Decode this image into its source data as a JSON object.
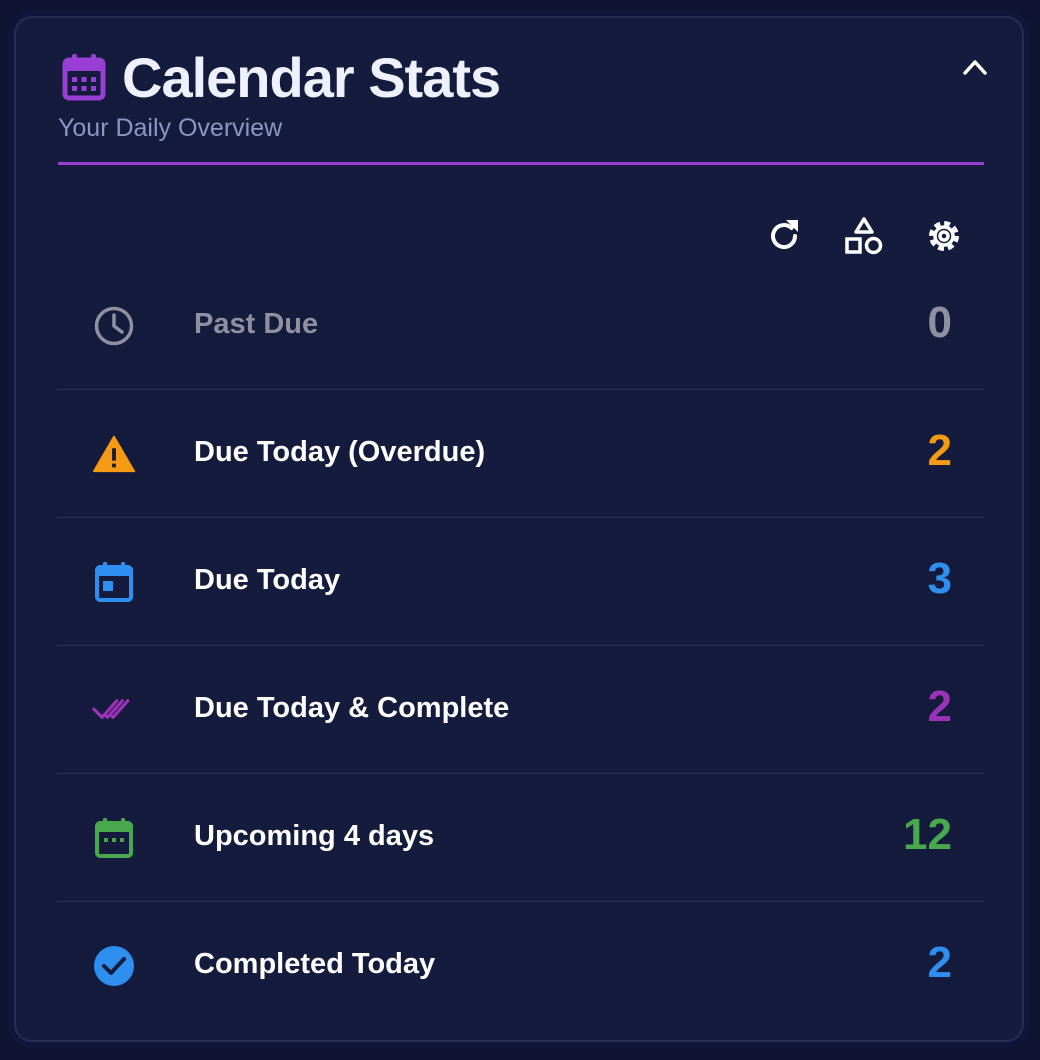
{
  "header": {
    "title": "Calendar Stats",
    "subtitle": "Your Daily Overview",
    "title_icon": "calendar-month-icon",
    "accent_color": "#9a3fd6",
    "collapse_icon": "chevron-up-icon"
  },
  "toolbar": {
    "items": [
      {
        "icon": "refresh-icon"
      },
      {
        "icon": "shapes-icon"
      },
      {
        "icon": "gear-icon"
      }
    ]
  },
  "stats": [
    {
      "label": "Past Due",
      "value": "0",
      "icon": "clock-icon",
      "color": "#8e929f"
    },
    {
      "label": "Due Today (Overdue)",
      "value": "2",
      "icon": "warning-icon",
      "color": "#f59a13"
    },
    {
      "label": "Due Today",
      "value": "3",
      "icon": "calendar-today-icon",
      "color": "#2f8ff0"
    },
    {
      "label": "Due Today & Complete",
      "value": "2",
      "icon": "double-check-icon",
      "color": "#9b32b8"
    },
    {
      "label": "Upcoming 4 days",
      "value": "12",
      "icon": "calendar-upcoming-icon",
      "color": "#47a84e"
    },
    {
      "label": "Completed Today",
      "value": "2",
      "icon": "check-circle-icon",
      "color": "#2f8ff0"
    }
  ]
}
